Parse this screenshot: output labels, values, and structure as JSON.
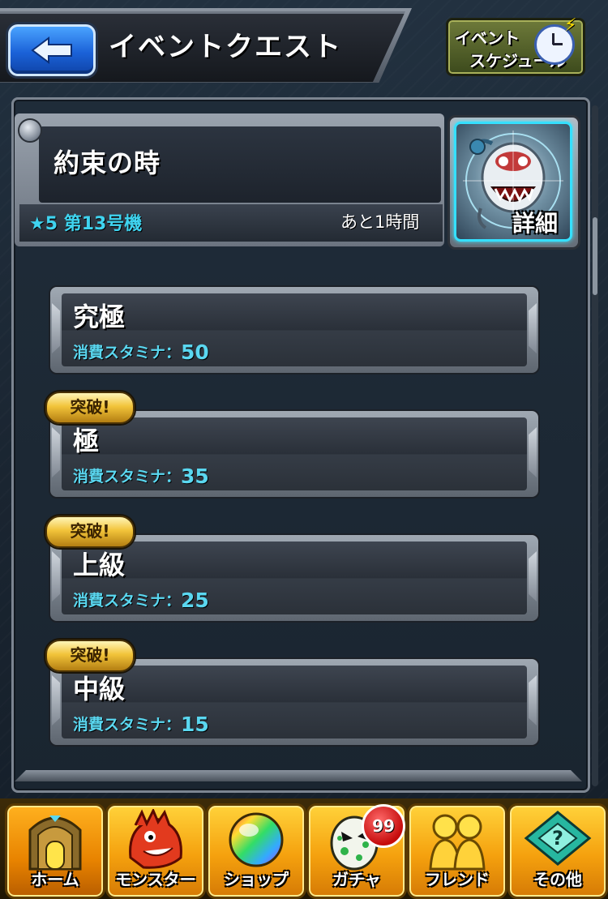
{
  "header": {
    "title": "イベントクエスト",
    "schedule_line1": "イベント",
    "schedule_line2": "スケジュール"
  },
  "event": {
    "title": "約束の時",
    "stage": "★5 第13号機",
    "remaining": "あと1時間",
    "detail_label": "詳細"
  },
  "quests": [
    {
      "name": "究極",
      "stamina_label": "消費スタミナ：",
      "stamina": "50",
      "badge": ""
    },
    {
      "name": "極",
      "stamina_label": "消費スタミナ：",
      "stamina": "35",
      "badge": "突破!"
    },
    {
      "name": "上級",
      "stamina_label": "消費スタミナ：",
      "stamina": "25",
      "badge": "突破!"
    },
    {
      "name": "中級",
      "stamina_label": "消費スタミナ：",
      "stamina": "15",
      "badge": "突破!"
    }
  ],
  "nav": {
    "items": [
      {
        "label": "ホーム",
        "icon": "home-icon",
        "active": true
      },
      {
        "label": "モンスター",
        "icon": "monster-icon"
      },
      {
        "label": "ショップ",
        "icon": "orb-icon"
      },
      {
        "label": "ガチャ",
        "icon": "egg-icon",
        "badge": "99"
      },
      {
        "label": "フレンド",
        "icon": "friends-icon"
      },
      {
        "label": "その他",
        "icon": "other-icon"
      }
    ]
  },
  "colors": {
    "accent_cyan": "#3fd4f0",
    "nav_gold": "#f5a10e",
    "back_blue": "#1b62d8"
  }
}
